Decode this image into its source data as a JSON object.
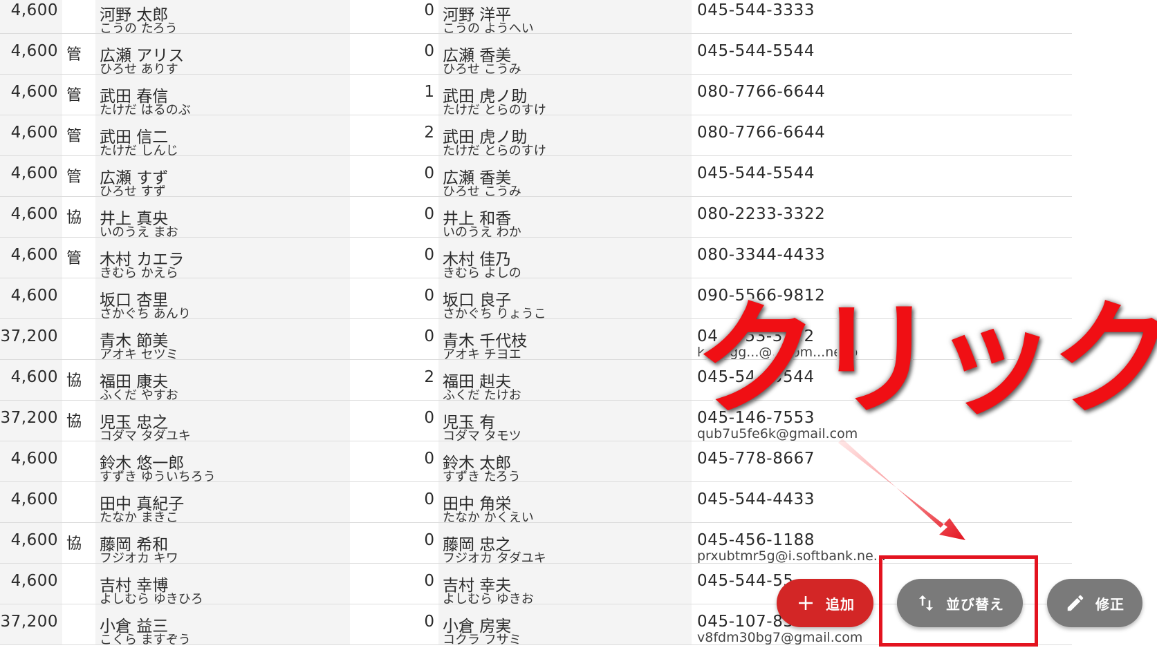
{
  "rows": [
    {
      "fee": "4,600",
      "kind": "",
      "name": "河野 太郎",
      "name_kana": "こうの たろう",
      "num": "0",
      "pname": "河野 洋平",
      "pname_kana": "こうの ようへい",
      "tel": "045-544-3333",
      "mail": ""
    },
    {
      "fee": "4,600",
      "kind": "管",
      "name": "広瀬 アリス",
      "name_kana": "ひろせ ありす",
      "num": "0",
      "pname": "広瀬 香美",
      "pname_kana": "ひろせ こうみ",
      "tel": "045-544-5544",
      "mail": ""
    },
    {
      "fee": "4,600",
      "kind": "管",
      "name": "武田 春信",
      "name_kana": "たけだ はるのぶ",
      "num": "1",
      "pname": "武田 虎ノ助",
      "pname_kana": "たけだ とらのすけ",
      "tel": "080-7766-6644",
      "mail": ""
    },
    {
      "fee": "4,600",
      "kind": "管",
      "name": "武田 信二",
      "name_kana": "たけだ しんじ",
      "num": "2",
      "pname": "武田 虎ノ助",
      "pname_kana": "たけだ とらのすけ",
      "tel": "080-7766-6644",
      "mail": ""
    },
    {
      "fee": "4,600",
      "kind": "管",
      "name": "広瀬 すず",
      "name_kana": "ひろせ すず",
      "num": "0",
      "pname": "広瀬 香美",
      "pname_kana": "ひろせ こうみ",
      "tel": "045-544-5544",
      "mail": ""
    },
    {
      "fee": "4,600",
      "kind": "協",
      "name": "井上 真央",
      "name_kana": "いのうえ まお",
      "num": "0",
      "pname": "井上 和香",
      "pname_kana": "いのうえ わか",
      "tel": "080-2233-3322",
      "mail": ""
    },
    {
      "fee": "4,600",
      "kind": "管",
      "name": "木村 カエラ",
      "name_kana": "きむら かえら",
      "num": "0",
      "pname": "木村 佳乃",
      "pname_kana": "きむら よしの",
      "tel": "080-3344-4433",
      "mail": ""
    },
    {
      "fee": "4,600",
      "kind": "",
      "name": "坂口 杏里",
      "name_kana": "さかぐち あんり",
      "num": "0",
      "pname": "坂口 良子",
      "pname_kana": "さかぐち りょうこ",
      "tel": "090-5566-9812",
      "mail": ""
    },
    {
      "fee": "37,200",
      "kind": "",
      "name": "青木 節美",
      "name_kana": "アオキ セツミ",
      "num": "0",
      "pname": "青木 千代枝",
      "pname_kana": "アオキ チヨエ",
      "tel": "04...753-3122",
      "mail": "kpungg...@...com...ne.jp"
    },
    {
      "fee": "4,600",
      "kind": "協",
      "name": "福田 康夫",
      "name_kana": "ふくだ やすお",
      "num": "2",
      "pname": "福田 赳夫",
      "pname_kana": "ふくだ たけお",
      "tel": "045-54...5544",
      "mail": ""
    },
    {
      "fee": "37,200",
      "kind": "協",
      "name": "児玉 忠之",
      "name_kana": "コダマ タダユキ",
      "num": "0",
      "pname": "児玉 有",
      "pname_kana": "コダマ タモツ",
      "tel": "045-146-7553",
      "mail": "qub7u5fe6k@gmail.com"
    },
    {
      "fee": "4,600",
      "kind": "",
      "name": "鈴木 悠一郎",
      "name_kana": "すずき ゆういちろう",
      "num": "0",
      "pname": "鈴木 太郎",
      "pname_kana": "すずき たろう",
      "tel": "045-778-8667",
      "mail": ""
    },
    {
      "fee": "4,600",
      "kind": "",
      "name": "田中 真紀子",
      "name_kana": "たなか まきこ",
      "num": "0",
      "pname": "田中 角栄",
      "pname_kana": "たなか かくえい",
      "tel": "045-544-4433",
      "mail": ""
    },
    {
      "fee": "4,600",
      "kind": "協",
      "name": "藤岡 希和",
      "name_kana": "フジオカ キワ",
      "num": "0",
      "pname": "藤岡 忠之",
      "pname_kana": "フジオカ タダユキ",
      "tel": "045-456-1188",
      "mail": "prxubtmr5g@i.softbank.ne..."
    },
    {
      "fee": "4,600",
      "kind": "",
      "name": "吉村 幸博",
      "name_kana": "よしむら ゆきひろ",
      "num": "0",
      "pname": "吉村 幸夫",
      "pname_kana": "よしむら ゆきお",
      "tel": "045-544-55...",
      "mail": ""
    },
    {
      "fee": "37,200",
      "kind": "",
      "name": "小倉 益三",
      "name_kana": "こくら ますぞう",
      "num": "0",
      "pname": "小倉 房実",
      "pname_kana": "コクラ フサミ",
      "tel": "045-107-83...",
      "mail": "v8fdm30bg7@gmail.com"
    }
  ],
  "fab": {
    "add_label": "追加",
    "sort_label": "並び替え",
    "edit_label": "修正"
  },
  "annotation": {
    "text": "クリック",
    "color": "#e3131f"
  },
  "colors": {
    "add": "#d32626",
    "secondary": "#7a7a7a"
  }
}
